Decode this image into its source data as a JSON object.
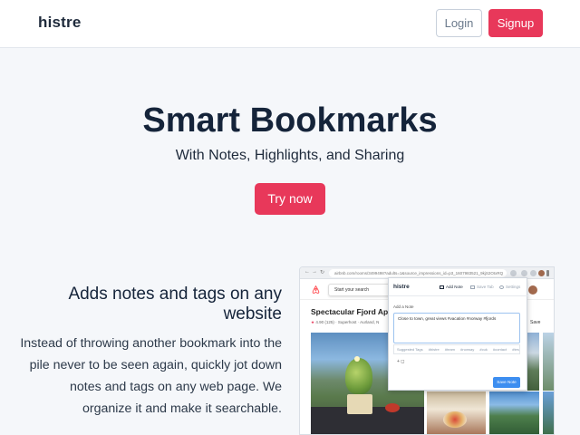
{
  "header": {
    "logo": "histre",
    "login_label": "Login",
    "signup_label": "Signup"
  },
  "hero": {
    "title": "Smart Bookmarks",
    "subtitle": "With Notes, Highlights, and Sharing",
    "cta_label": "Try now"
  },
  "feature": {
    "title": "Adds notes and tags on any website",
    "body": "Instead of throwing another bookmark into the pile never to be seen again, quickly jot down notes and tags on any web page. We organize it and make it searchable."
  },
  "browser_mock": {
    "nav_icons": [
      "←",
      "→",
      "↻"
    ],
    "url": "airbnb.com/rooms/3499498?adults=1&source_impressions_id=p3_1607983521_9kjS2OIxRQ",
    "site": {
      "search_placeholder": "Start your search",
      "listing_title": "Spectacular Fjord Apar",
      "rating": "4.90",
      "reviews": "(125)",
      "superhost": "Superhost",
      "location": "Aurland, N",
      "save_label": "Save"
    },
    "popup": {
      "logo": "histre",
      "tabs": [
        "Add Note",
        "Save Tab",
        "Settings"
      ],
      "add_note_label": "Add a Note",
      "note_text": "Close to town, great views #vacation #norway #fjords",
      "suggested_label": "Suggested Tags",
      "suggested_tags": [
        "#bistre",
        "#team",
        "#norway",
        "#cuk",
        "#contact",
        "#tes"
      ],
      "add_row": "+ ◻",
      "save_label": "Save Note"
    }
  },
  "colors": {
    "accent": "#e8385a",
    "page_bg": "#f5f7fa",
    "text_dark": "#15243a",
    "button_blue": "#3d8ef0"
  }
}
